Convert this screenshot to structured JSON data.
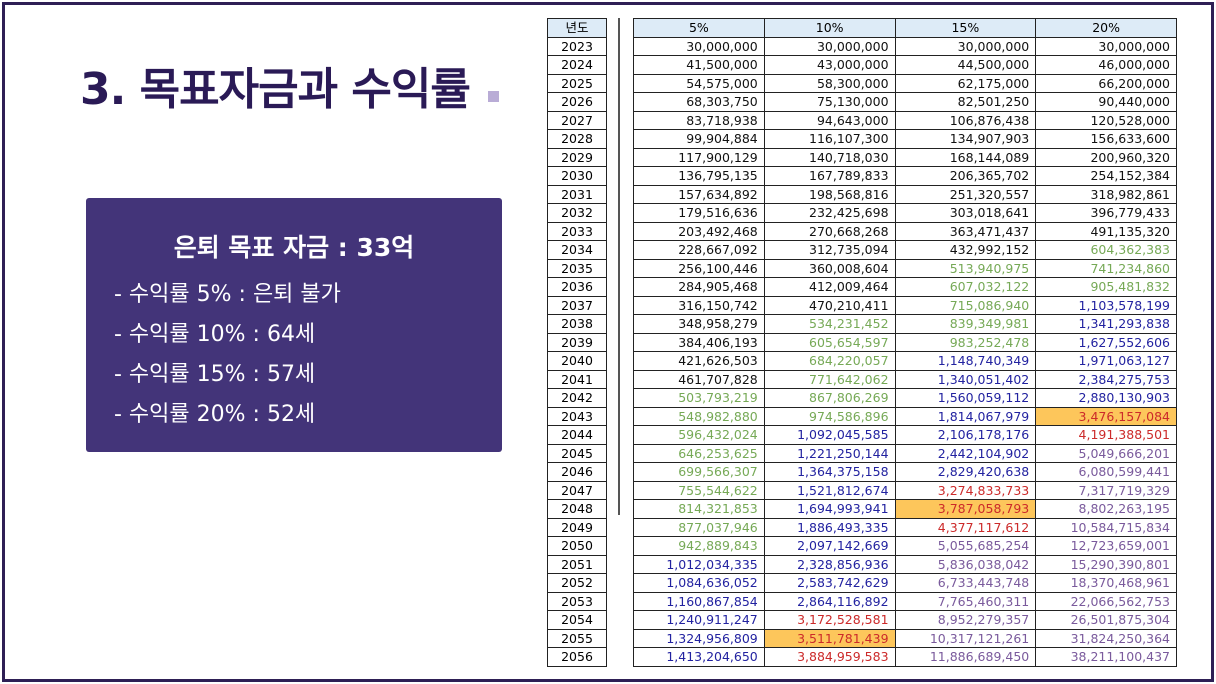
{
  "slide": {
    "title": "3. 목표자금과 수익률",
    "box": {
      "heading": "은퇴 목표 자금 : 33억",
      "lines": [
        "- 수익률 5% : 은퇴 불가",
        "- 수익률 10% : 64세",
        "- 수익률 15% : 57세",
        "- 수익률 20% : 52세"
      ]
    }
  },
  "colors": {
    "frame": "#2e1f55",
    "box": "#433479",
    "header_bg": "#ddebf7",
    "highlight": "#fdc65b",
    "tier_black": "#111111",
    "tier_green": "#76a956",
    "tier_blue": "#2222a0",
    "tier_red": "#cc2a2a",
    "tier_purple": "#7a5a9c"
  },
  "table": {
    "year_header": "년도",
    "headers": [
      "5%",
      "10%",
      "15%",
      "20%"
    ],
    "highlighted": [
      [
        "2043",
        3
      ],
      [
        "2048",
        2
      ],
      [
        "2055",
        1
      ]
    ],
    "rows": [
      [
        "2023",
        "30,000,000",
        "30,000,000",
        "30,000,000",
        "30,000,000"
      ],
      [
        "2024",
        "41,500,000",
        "43,000,000",
        "44,500,000",
        "46,000,000"
      ],
      [
        "2025",
        "54,575,000",
        "58,300,000",
        "62,175,000",
        "66,200,000"
      ],
      [
        "2026",
        "68,303,750",
        "75,130,000",
        "82,501,250",
        "90,440,000"
      ],
      [
        "2027",
        "83,718,938",
        "94,643,000",
        "106,876,438",
        "120,528,000"
      ],
      [
        "2028",
        "99,904,884",
        "116,107,300",
        "134,907,903",
        "156,633,600"
      ],
      [
        "2029",
        "117,900,129",
        "140,718,030",
        "168,144,089",
        "200,960,320"
      ],
      [
        "2030",
        "136,795,135",
        "167,789,833",
        "206,365,702",
        "254,152,384"
      ],
      [
        "2031",
        "157,634,892",
        "198,568,816",
        "251,320,557",
        "318,982,861"
      ],
      [
        "2032",
        "179,516,636",
        "232,425,698",
        "303,018,641",
        "396,779,433"
      ],
      [
        "2033",
        "203,492,468",
        "270,668,268",
        "363,471,437",
        "491,135,320"
      ],
      [
        "2034",
        "228,667,092",
        "312,735,094",
        "432,992,152",
        "604,362,383"
      ],
      [
        "2035",
        "256,100,446",
        "360,008,604",
        "513,940,975",
        "741,234,860"
      ],
      [
        "2036",
        "284,905,468",
        "412,009,464",
        "607,032,122",
        "905,481,832"
      ],
      [
        "2037",
        "316,150,742",
        "470,210,411",
        "715,086,940",
        "1,103,578,199"
      ],
      [
        "2038",
        "348,958,279",
        "534,231,452",
        "839,349,981",
        "1,341,293,838"
      ],
      [
        "2039",
        "384,406,193",
        "605,654,597",
        "983,252,478",
        "1,627,552,606"
      ],
      [
        "2040",
        "421,626,503",
        "684,220,057",
        "1,148,740,349",
        "1,971,063,127"
      ],
      [
        "2041",
        "461,707,828",
        "771,642,062",
        "1,340,051,402",
        "2,384,275,753"
      ],
      [
        "2042",
        "503,793,219",
        "867,806,269",
        "1,560,059,112",
        "2,880,130,903"
      ],
      [
        "2043",
        "548,982,880",
        "974,586,896",
        "1,814,067,979",
        "3,476,157,084"
      ],
      [
        "2044",
        "596,432,024",
        "1,092,045,585",
        "2,106,178,176",
        "4,191,388,501"
      ],
      [
        "2045",
        "646,253,625",
        "1,221,250,144",
        "2,442,104,902",
        "5,049,666,201"
      ],
      [
        "2046",
        "699,566,307",
        "1,364,375,158",
        "2,829,420,638",
        "6,080,599,441"
      ],
      [
        "2047",
        "755,544,622",
        "1,521,812,674",
        "3,274,833,733",
        "7,317,719,329"
      ],
      [
        "2048",
        "814,321,853",
        "1,694,993,941",
        "3,787,058,793",
        "8,802,263,195"
      ],
      [
        "2049",
        "877,037,946",
        "1,886,493,335",
        "4,377,117,612",
        "10,584,715,834"
      ],
      [
        "2050",
        "942,889,843",
        "2,097,142,669",
        "5,055,685,254",
        "12,723,659,001"
      ],
      [
        "2051",
        "1,012,034,335",
        "2,328,856,936",
        "5,836,038,042",
        "15,290,390,801"
      ],
      [
        "2052",
        "1,084,636,052",
        "2,583,742,629",
        "6,733,443,748",
        "18,370,468,961"
      ],
      [
        "2053",
        "1,160,867,854",
        "2,864,116,892",
        "7,765,460,311",
        "22,066,562,753"
      ],
      [
        "2054",
        "1,240,911,247",
        "3,172,528,581",
        "8,952,279,357",
        "26,501,875,304"
      ],
      [
        "2055",
        "1,324,956,809",
        "3,511,781,439",
        "10,317,121,261",
        "31,824,250,364"
      ],
      [
        "2056",
        "1,413,204,650",
        "3,884,959,583",
        "11,886,689,450",
        "38,211,100,437"
      ]
    ]
  }
}
